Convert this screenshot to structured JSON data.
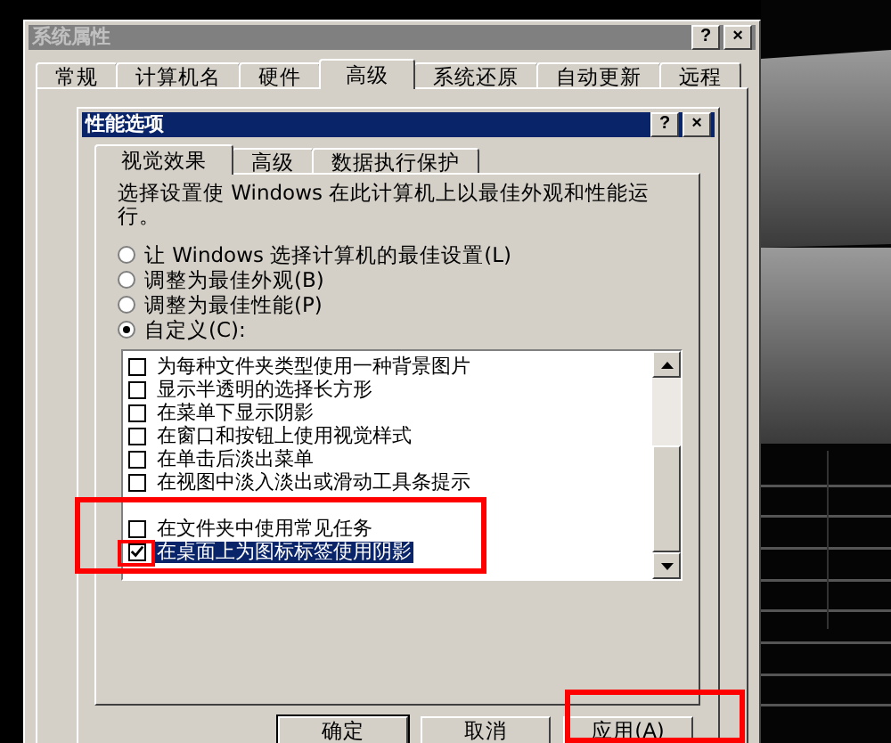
{
  "system_window": {
    "title": "系统属性",
    "active": false,
    "title_buttons": [
      "?",
      "×"
    ],
    "tabs": [
      {
        "label": "常规",
        "selected": false
      },
      {
        "label": "计算机名",
        "selected": false
      },
      {
        "label": "硬件",
        "selected": false
      },
      {
        "label": "高级",
        "selected": true
      },
      {
        "label": "系统还原",
        "selected": false
      },
      {
        "label": "自动更新",
        "selected": false
      },
      {
        "label": "远程",
        "selected": false
      }
    ]
  },
  "performance_dialog": {
    "title": "性能选项",
    "active": true,
    "title_buttons": [
      "?",
      "×"
    ],
    "tabs": [
      {
        "label": "视觉效果",
        "selected": true
      },
      {
        "label": "高级",
        "selected": false
      },
      {
        "label": "数据执行保护",
        "selected": false
      }
    ],
    "description": "选择设置使 Windows 在此计算机上以最佳外观和性能运行。",
    "options": [
      {
        "label": "让 Windows 选择计算机的最佳设置(L)",
        "selected": false
      },
      {
        "label": "调整为最佳外观(B)",
        "selected": false
      },
      {
        "label": "调整为最佳性能(P)",
        "selected": false
      },
      {
        "label": "自定义(C):",
        "selected": true
      }
    ],
    "effects": [
      {
        "label": "为每种文件夹类型使用一种背景图片",
        "checked": false,
        "selected": false
      },
      {
        "label": "显示半透明的选择长方形",
        "checked": false,
        "selected": false
      },
      {
        "label": "在菜单下显示阴影",
        "checked": false,
        "selected": false
      },
      {
        "label": "在窗口和按钮上使用视觉样式",
        "checked": false,
        "selected": false
      },
      {
        "label": "在单击后淡出菜单",
        "checked": false,
        "selected": false
      },
      {
        "label": "在视图中淡入淡出或滑动工具条提示",
        "checked": false,
        "selected": false
      },
      {
        "kind": "covered"
      },
      {
        "label": "在文件夹中使用常见任务",
        "checked": false,
        "selected": false
      },
      {
        "label": "在桌面上为图标标签使用阴影",
        "checked": true,
        "selected": true
      },
      {
        "kind": "covered"
      }
    ],
    "buttons": [
      "确定",
      "取消",
      "应用(A)"
    ]
  }
}
